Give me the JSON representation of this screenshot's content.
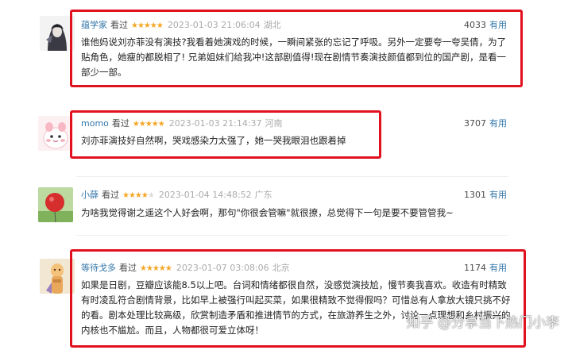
{
  "reviews": [
    {
      "user": "蕴学家",
      "watched": "看过",
      "stars": "★★★★★",
      "stars_off": "",
      "time": "2023-01-03 21:06:04",
      "location": "湖北",
      "votes": "4033",
      "useful": "有用",
      "lines": [
        "谁他妈说刘亦菲没有演技?我看着她演戏的时候，一瞬间紧张的忘记了呼吸。另外一定要夸一夸吴倩，为了",
        "贴角色，她瘦的都脱相了! 兄弟姐妹们给我冲!这部剧值得!现在剧情节奏演技颜值都到位的国产剧，是看一",
        "部少一部。"
      ]
    },
    {
      "user": "momo",
      "watched": "看过",
      "stars": "★★★★★",
      "stars_off": "",
      "time": "2023-01-03 21:14:37",
      "location": "河南",
      "votes": "3707",
      "useful": "有用",
      "lines": [
        "刘亦菲演技好自然啊，哭戏感染力太强了，她一哭我眼泪也跟着掉"
      ]
    },
    {
      "user": "小薛",
      "watched": "看过",
      "stars": "★★★★",
      "stars_off": "★",
      "time": "2023-01-04 14:48:52",
      "location": "广东",
      "votes": "1301",
      "useful": "有用",
      "lines": [
        "为啥我觉得谢之遥这个人好会啊，那句\"你很会管嘛\"就很撩，总觉得下一句是要不要管管我~"
      ]
    },
    {
      "user": "等待戈多",
      "watched": "看过",
      "stars": "★★★★★",
      "stars_off": "",
      "time": "2023-01-07 03:08:06",
      "location": "北京",
      "votes": "1174",
      "useful": "有用",
      "lines": [
        "如果是日剧，豆瓣应该能8.5以上吧。台词和情绪都很自然，没感觉演技尬，慢节奏我喜欢。收造有时精致",
        "有时凌乱符合剧情背景，比如早上被强行叫起买菜，如果很精致不觉得假吗？可惜总有人拿放大镜只挑不好",
        "的看。剧本处理比较高级，欣赏制造矛盾和推进情节的方式，在旅游养生之外，讨论一点理想和乡村振兴的",
        "内核也不尴尬。而且，人物都很可爱立体呀！"
      ]
    }
  ],
  "watermark": "知乎 @分享当下热门小李"
}
